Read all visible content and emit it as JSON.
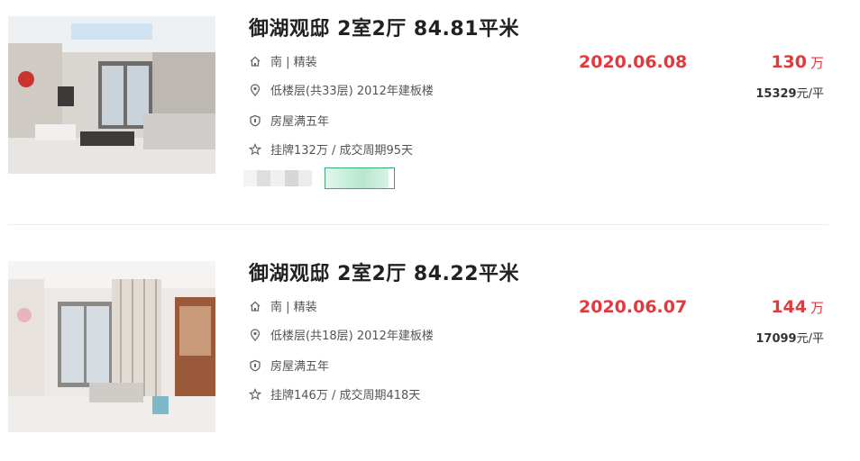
{
  "listings": [
    {
      "title": "御湖观邸 2室2厅 84.81平米",
      "orientation": "南 | 精装",
      "floor": "低楼层(共33层) 2012年建板楼",
      "tag": "房屋满五年",
      "deal": "挂牌132万 / 成交周期95天",
      "date": "2020.06.08",
      "price": "130",
      "price_unit": "万",
      "unit_price": "15329",
      "unit_price_suffix": "元/平"
    },
    {
      "title": "御湖观邸 2室2厅 84.22平米",
      "orientation": "南 | 精装",
      "floor": "低楼层(共18层) 2012年建板楼",
      "tag": "房屋满五年",
      "deal": "挂牌146万 / 成交周期418天",
      "date": "2020.06.07",
      "price": "144",
      "price_unit": "万",
      "unit_price": "17099",
      "unit_price_suffix": "元/平"
    }
  ],
  "icons": [
    "house-icon",
    "location-pin-icon",
    "shield-icon",
    "star-icon"
  ],
  "colors": {
    "accent_red": "#e4393c",
    "tag_green": "#3aa875"
  }
}
